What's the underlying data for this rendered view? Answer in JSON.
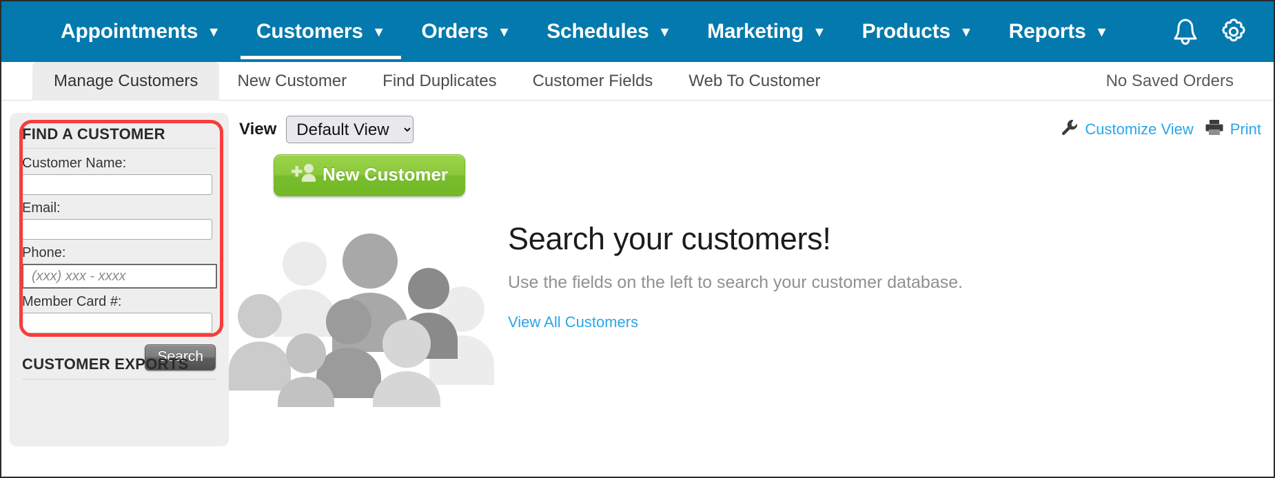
{
  "topnav": {
    "items": [
      {
        "label": "Appointments",
        "caret": "▼",
        "active": false
      },
      {
        "label": "Customers",
        "caret": "▼",
        "active": true
      },
      {
        "label": "Orders",
        "caret": "▼",
        "active": false
      },
      {
        "label": "Schedules",
        "caret": "▼",
        "active": false
      },
      {
        "label": "Marketing",
        "caret": "▼",
        "active": false
      },
      {
        "label": "Products",
        "caret": "▼",
        "active": false
      },
      {
        "label": "Reports",
        "caret": "▼",
        "active": false
      }
    ],
    "icons": [
      {
        "name": "notifications-bell-icon"
      },
      {
        "name": "settings-gear-icon"
      }
    ],
    "background_color": "#0479ad"
  },
  "subnav": {
    "tabs": [
      {
        "label": "Manage Customers",
        "active": true
      },
      {
        "label": "New Customer",
        "active": false
      },
      {
        "label": "Find Duplicates",
        "active": false
      },
      {
        "label": "Customer Fields",
        "active": false
      },
      {
        "label": "Web To Customer",
        "active": false
      }
    ],
    "saved_orders": "No Saved Orders"
  },
  "sidebar": {
    "find_panel": {
      "title": "FIND A CUSTOMER",
      "highlight_color": "#fa3c3c",
      "fields": [
        {
          "label": "Customer Name:",
          "value": "",
          "placeholder": "",
          "focused": false
        },
        {
          "label": "Email:",
          "value": "",
          "placeholder": "",
          "focused": false
        },
        {
          "label": "Phone:",
          "value": "",
          "placeholder": "(xxx) xxx - xxxx",
          "focused": true
        },
        {
          "label": "Member Card #:",
          "value": "",
          "placeholder": "",
          "focused": false
        }
      ],
      "search_button": "Search"
    },
    "exports_title": "CUSTOMER EXPORTS"
  },
  "main": {
    "view_label": "View",
    "view_selected": "Default View",
    "view_options": [
      "Default View"
    ],
    "tools": [
      {
        "icon": "wrench-icon",
        "label": "Customize View"
      },
      {
        "icon": "printer-icon",
        "label": "Print"
      }
    ],
    "new_customer_button": "New Customer",
    "new_customer_icon": "add-person-icon",
    "hero": {
      "title": "Search your customers!",
      "subtitle": "Use the fields on the left to search your customer database.",
      "link": "View All Customers"
    },
    "illustration": "crowd-of-people-icon",
    "link_color": "#2aa6e8"
  }
}
